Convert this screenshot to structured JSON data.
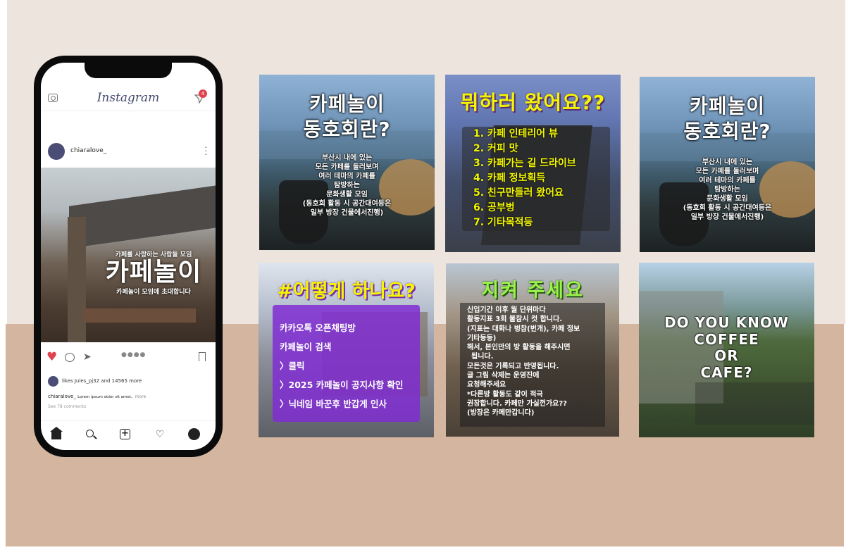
{
  "instagram": {
    "logo": "Instagram",
    "notification_count": "4",
    "username": "chiaralove_",
    "post_overlay": {
      "subtitle_top": "카페를 사랑하는 사람들 모임",
      "title": "카페놀이",
      "subtitle_bottom": "카페놀이 모임에 초대합니다"
    },
    "pager": "●●●●",
    "likes_text": "likes Jules_pj32 and 14565 more",
    "caption_user": "chiaralove_",
    "caption_text": "Lorem ipsum dolor sit amet..",
    "caption_more": "more",
    "comments_text": "See 78 comments"
  },
  "tiles": {
    "intro": {
      "title_line1": "카페놀이",
      "title_line2": "동호회란?",
      "desc": [
        "부산시 내에 있는",
        "모든 카페를 둘러보며",
        "여러 테마의 카페를",
        "탐방하는",
        "문화생활 모임",
        "(동호회 활동 시 공간대여등은",
        "일부 방장 건물에서진행)"
      ]
    },
    "purpose": {
      "title": "뭐하러 왔어요??",
      "items": [
        "1. 카페 인테리어 뷰",
        "2. 커피 맛",
        "3. 카페가는 길 드라이브",
        "4. 카페 정보획득",
        "5. 친구만들러 왔어요",
        "6. 공부벙",
        "7. 기타목적등"
      ]
    },
    "howto": {
      "title": "#어떻게 하나요?",
      "items": [
        "카카오톡 오픈채팅방",
        "카페놀이 검색",
        "〉클릭",
        "〉2025 카페놀이 공지사항 확인",
        "〉닉네임 바꾼후 반갑게 인사"
      ]
    },
    "rules": {
      "title": "지켜 주세요",
      "lines": [
        "신입기간 이후 월 단위마다",
        "활동지표 3회 불참시 컷 합니다.",
        "(지표는 대화나 벙참(번개), 카페 정보",
        "기타등등)",
        "해서, 본인만의 방 활동을 해주시면",
        "됩니다.",
        "모든것은 기록되고 반영됩니다.",
        "글 그림 삭제는 운영진에",
        "요청해주세요",
        "*다른방 활동도 같이 적극",
        "권장합니다. 카페만 가실껀가요??",
        "(방장은 카페만갑니다)"
      ]
    },
    "coffee": {
      "lines": [
        "DO YOU KNOW",
        "COFFEE",
        "OR",
        "CAFE?"
      ]
    }
  }
}
